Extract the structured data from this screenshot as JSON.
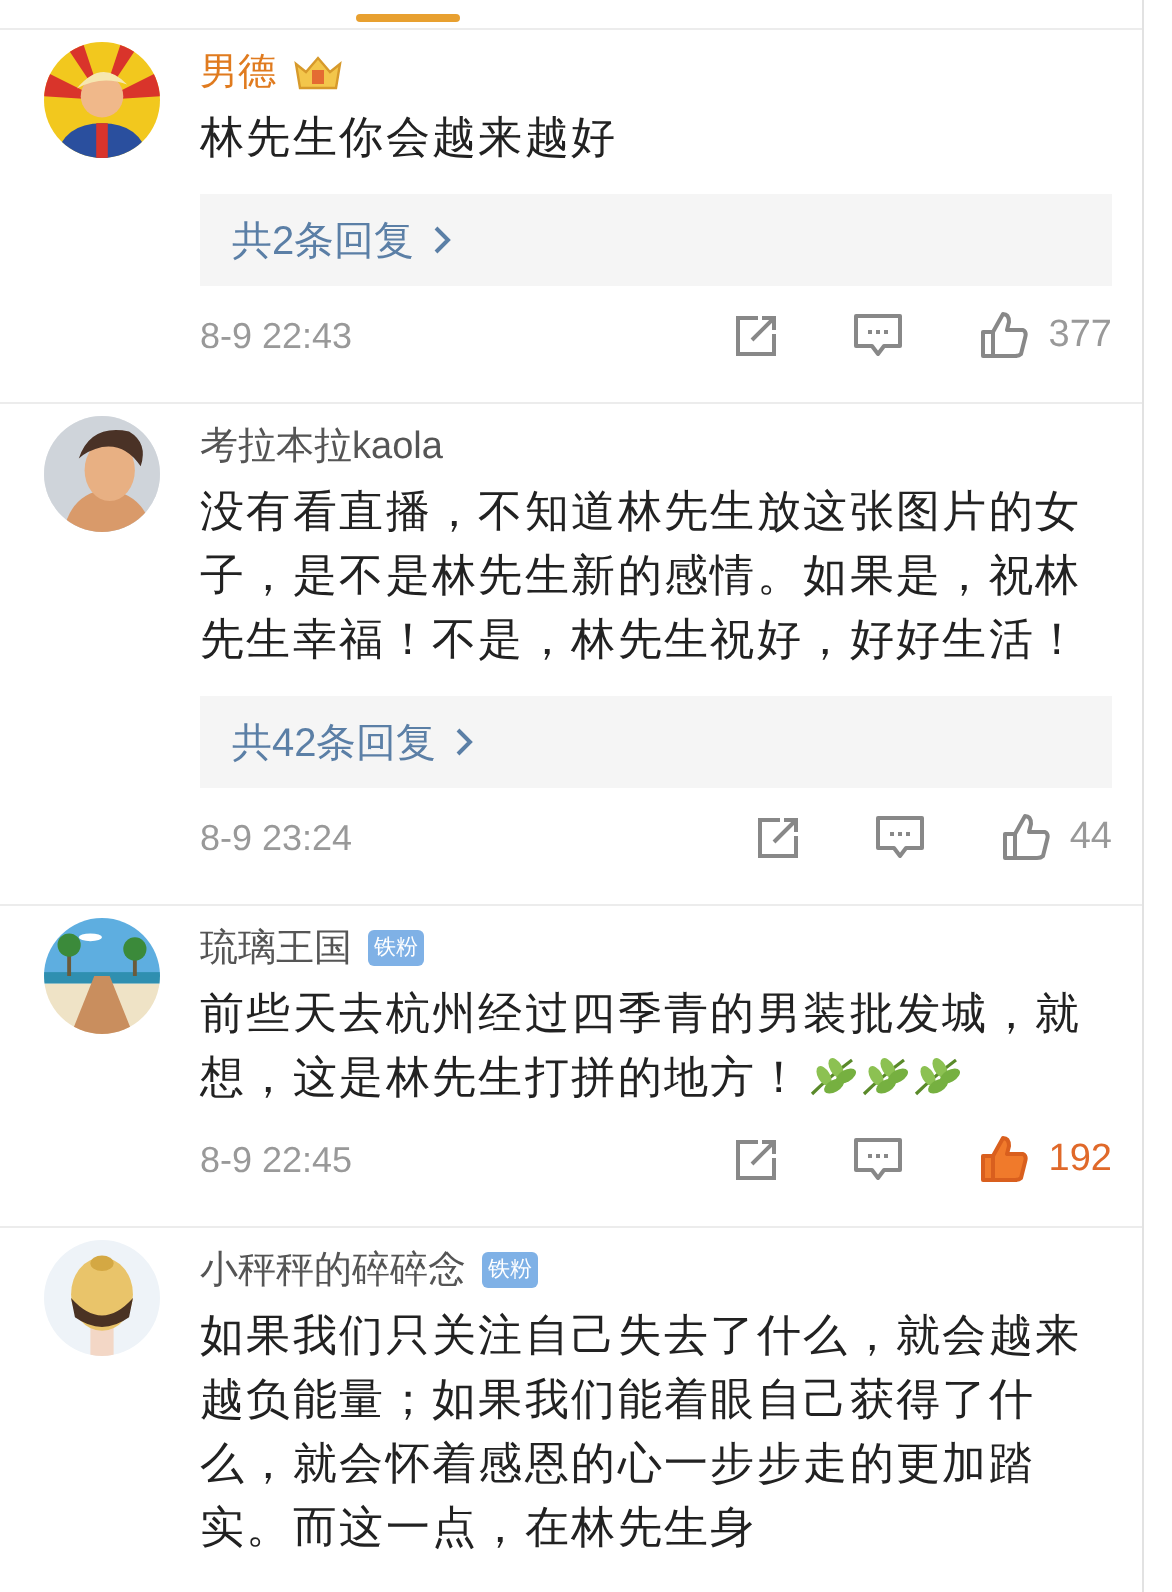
{
  "comments": [
    {
      "name": "男德",
      "vip": true,
      "badge": {
        "kind": "crown"
      },
      "text": "林先生你会越来越好",
      "replies": "共2条回复",
      "time": "8-9 22:43",
      "likes": "377",
      "liked": false
    },
    {
      "name": "考拉本拉kaola",
      "vip": false,
      "text": "没有看直播，不知道林先生放这张图片的女子，是不是林先生新的感情。如果是，祝林先生幸福！不是，林先生祝好，好好生活！",
      "replies": "共42条回复",
      "time": "8-9 23:24",
      "likes": "44",
      "liked": false
    },
    {
      "name": "琉璃王国",
      "vip": false,
      "badge": {
        "kind": "label",
        "text": "铁粉"
      },
      "text": "前些天去杭州经过四季青的男装批发城，就想，这是林先生打拼的地方！",
      "emojis": [
        {
          "kind": "leaf"
        },
        {
          "kind": "leaf"
        },
        {
          "kind": "leaf"
        }
      ],
      "time": "8-9 22:45",
      "likes": "192",
      "liked": true
    },
    {
      "name": "小秤秤的碎碎念",
      "vip": false,
      "badge": {
        "kind": "label",
        "text": "铁粉"
      },
      "text": "如果我们只关注自己失去了什么，就会越来越负能量；如果我们能着眼自己获得了什么，就会怀着感恩的心一步步走的更加踏实。而这一点，在林先生身"
    }
  ]
}
